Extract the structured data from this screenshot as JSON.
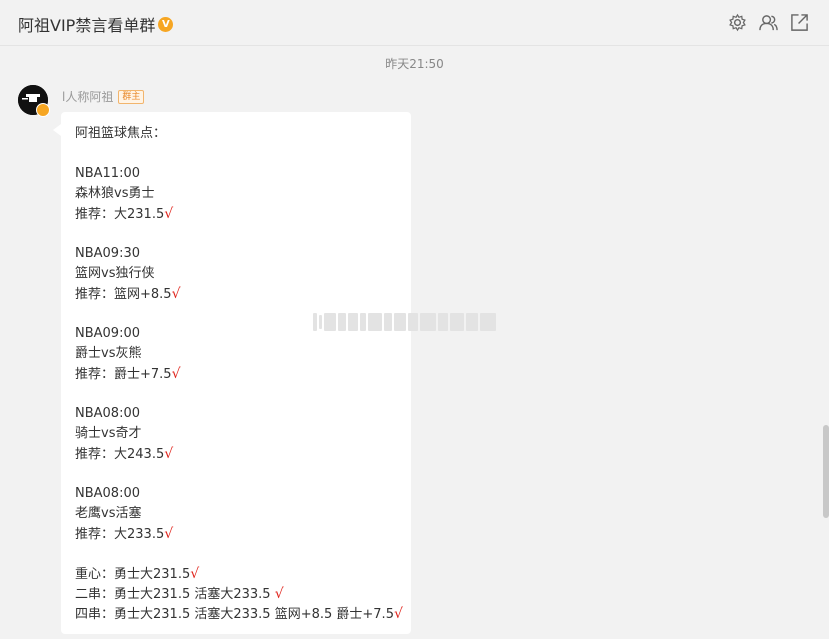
{
  "header": {
    "title": "阿祖VIP禁言看单群",
    "badge": "V",
    "icons": [
      "settings-icon",
      "members-icon",
      "popout-icon"
    ]
  },
  "timestamp": "昨天21:50",
  "message": {
    "sender": "l人称阿祖",
    "role": "群主",
    "lines": [
      {
        "text": "阿祖篮球焦点：",
        "check": false
      },
      {
        "text": "",
        "check": false
      },
      {
        "text": "NBA11:00",
        "check": false
      },
      {
        "text": "森林狼vs勇士",
        "check": false
      },
      {
        "text": "推荐：大231.5",
        "check": true
      },
      {
        "text": "",
        "check": false
      },
      {
        "text": "NBA09:30",
        "check": false
      },
      {
        "text": "篮网vs独行侠",
        "check": false
      },
      {
        "text": "推荐：篮网+8.5",
        "check": true
      },
      {
        "text": "",
        "check": false
      },
      {
        "text": "NBA09:00",
        "check": false
      },
      {
        "text": "爵士vs灰熊",
        "check": false
      },
      {
        "text": "推荐：爵士+7.5",
        "check": true
      },
      {
        "text": "",
        "check": false
      },
      {
        "text": "NBA08:00",
        "check": false
      },
      {
        "text": "骑士vs奇才",
        "check": false
      },
      {
        "text": "推荐：大243.5",
        "check": true
      },
      {
        "text": "",
        "check": false
      },
      {
        "text": "NBA08:00",
        "check": false
      },
      {
        "text": "老鹰vs活塞",
        "check": false
      },
      {
        "text": "推荐：大233.5",
        "check": true
      },
      {
        "text": "",
        "check": false
      },
      {
        "text": "重心：勇士大231.5",
        "check": true
      },
      {
        "text": "二串：勇士大231.5 活塞大233.5 ",
        "check": true
      },
      {
        "text": "四串：勇士大231.5 活塞大233.5 篮网+8.5 爵士+7.5",
        "check": true
      }
    ],
    "check_mark": "√"
  },
  "colors": {
    "background": "#f2f2f2",
    "bubble": "#ffffff",
    "check": "#e0241c",
    "badge": "#f6a623"
  }
}
